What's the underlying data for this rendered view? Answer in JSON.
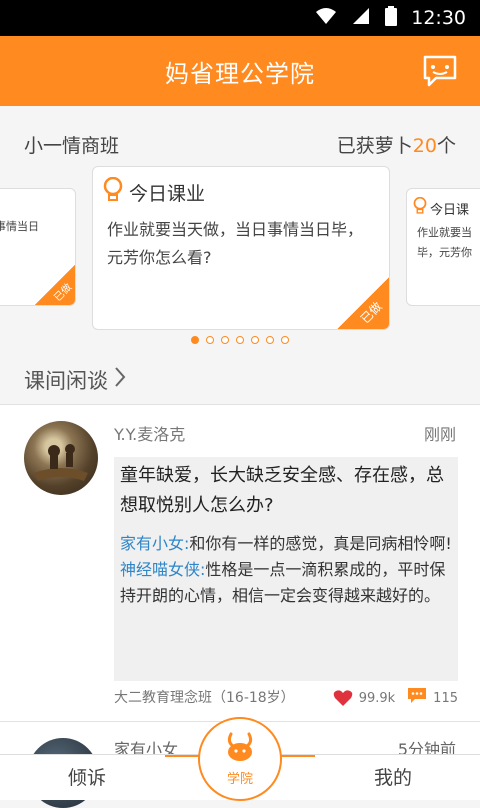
{
  "statusbar": {
    "time": "12:30"
  },
  "header": {
    "title": "妈省理公学院"
  },
  "class": {
    "name": "小一情商班",
    "carrots_prefix": "已获萝卜",
    "carrots_count": "20",
    "carrots_suffix": "个"
  },
  "cards": {
    "left": {
      "body": "事情当日",
      "tag": "已做"
    },
    "main": {
      "title": "今日课业",
      "body": "作业就要当天做，当日事情当日毕，元芳你怎么看?",
      "tag": "已做"
    },
    "right": {
      "title": "今日课",
      "body1": "作业就要当",
      "body2": "毕，元芳你"
    }
  },
  "pagination": {
    "total": 7,
    "active": 0
  },
  "chat": {
    "title": "课间闲谈"
  },
  "post": {
    "author": "Y.Y.麦洛克",
    "time": "刚刚",
    "question": "童年缺爱，长大缺乏安全感、存在感，总想取悦别人怎么办?",
    "replies": [
      {
        "who": "家有小女:",
        "text": "和你有一样的感觉，真是同病相怜啊!"
      },
      {
        "who": "神经喵女侠:",
        "text": "性格是一点一滴积累成的，平时保持开朗的心情，相信一定会变得越来越好的。"
      }
    ],
    "class_info": "大二教育理念班（16-18岁）",
    "likes": "99.9k",
    "comments": "115"
  },
  "post2": {
    "author": "家有小女",
    "time": "5分钟前"
  },
  "tabs": {
    "left": "倾诉",
    "center": "学院",
    "right": "我的"
  },
  "colors": {
    "accent": "#ff8a1f",
    "reply_name": "#2e86c8",
    "heart": "#e0323c"
  }
}
